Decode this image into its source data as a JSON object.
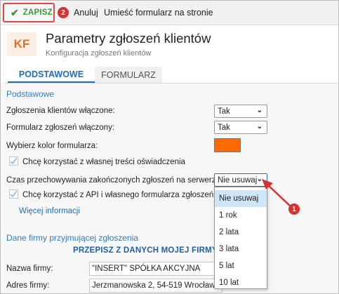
{
  "toolbar": {
    "save_label": "ZAPISZ",
    "step_badge": "2",
    "cancel_label": "Anuluj",
    "embed_label": "Umieść formularz na stronie"
  },
  "header": {
    "logo_text": "KF",
    "title": "Parametry zgłoszeń klientów",
    "subtitle": "Konfiguracja zgłoszeń klientów"
  },
  "tabs": [
    {
      "label": "PODSTAWOWE",
      "active": true
    },
    {
      "label": "FORMULARZ",
      "active": false
    }
  ],
  "basic": {
    "section_title": "Podstawowe",
    "requests_enabled_label": "Zgłoszenia klientów włączone:",
    "requests_enabled_value": "Tak",
    "form_enabled_label": "Formularz zgłoszeń włączony:",
    "form_enabled_value": "Tak",
    "color_label": "Wybierz kolor formularza:",
    "form_color": "#ff6a00",
    "custom_statement_label": "Chcę korzystać z własnej treści oświadczenia",
    "retention_label": "Czas przechowywania zakończonych zgłoszeń na serwerze:",
    "retention_value": "Nie usuwaj",
    "api_label": "Chcę korzystać z API i własnego formularza zgłoszeń kli",
    "more_info_link": "Więcej informacji"
  },
  "retention_options": [
    "Nie usuwaj",
    "1 rok",
    "2 lata",
    "3 lata",
    "5 lat",
    "10 lat"
  ],
  "annotation": {
    "step_badge": "1"
  },
  "company": {
    "section_title": "Dane firmy przyjmującej zgłoszenia",
    "copy_button": "PRZEPISZ Z DANYCH MOJEJ FIRMY",
    "name_label": "Nazwa firmy:",
    "name_value": "\"INSERT\" SPÓŁKA AKCYJNA",
    "address_label": "Adres firmy:",
    "address_value": "Jerzmanowska 2, 54-519 Wrocław"
  },
  "colors": {
    "accent": "#1f6fb8",
    "save_green": "#3a9a3a",
    "annotation_red": "#d93030",
    "logo_orange": "#e46f2a"
  }
}
